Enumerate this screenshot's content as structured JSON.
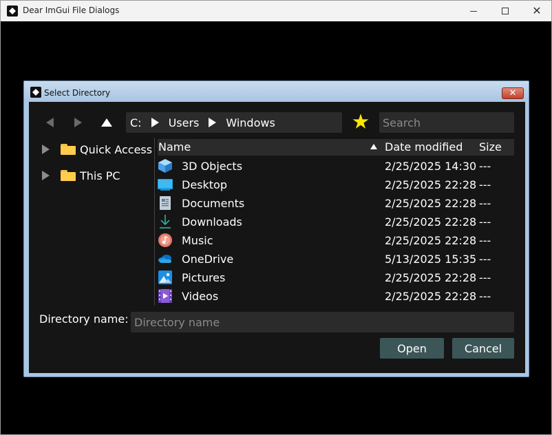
{
  "os_window": {
    "title": "Dear ImGui File Dialogs"
  },
  "dialog": {
    "title": "Select Directory",
    "breadcrumbs": [
      "C:",
      "Users",
      "Windows"
    ],
    "search": {
      "placeholder": "Search",
      "value": ""
    },
    "sidebar": [
      {
        "label": "Quick Access",
        "icon": "folder-icon"
      },
      {
        "label": "This PC",
        "icon": "folder-icon"
      }
    ],
    "columns": {
      "name": "Name",
      "date": "Date modified",
      "size": "Size",
      "sorted_by": "Name",
      "sort": "ascending"
    },
    "files": [
      {
        "name": "3D Objects",
        "date": "2/25/2025 14:30",
        "size": "---",
        "icon": "3d-objects-icon"
      },
      {
        "name": "Desktop",
        "date": "2/25/2025 22:28",
        "size": "---",
        "icon": "desktop-icon"
      },
      {
        "name": "Documents",
        "date": "2/25/2025 22:28",
        "size": "---",
        "icon": "documents-icon"
      },
      {
        "name": "Downloads",
        "date": "2/25/2025 22:28",
        "size": "---",
        "icon": "downloads-icon"
      },
      {
        "name": "Music",
        "date": "2/25/2025 22:28",
        "size": "---",
        "icon": "music-icon"
      },
      {
        "name": "OneDrive",
        "date": "5/13/2025 15:35",
        "size": "---",
        "icon": "onedrive-icon"
      },
      {
        "name": "Pictures",
        "date": "2/25/2025 22:28",
        "size": "---",
        "icon": "pictures-icon"
      },
      {
        "name": "Videos",
        "date": "2/25/2025 22:28",
        "size": "---",
        "icon": "videos-icon"
      }
    ],
    "footer": {
      "dirname_label": "Directory name:",
      "dirname_placeholder": "Directory name",
      "dirname_value": "",
      "open_label": "Open",
      "cancel_label": "Cancel"
    },
    "colors": {
      "background": "#151515",
      "button": "#3c5658",
      "favorite_star": "#ffe600",
      "frame": "#a9c7e4"
    }
  }
}
